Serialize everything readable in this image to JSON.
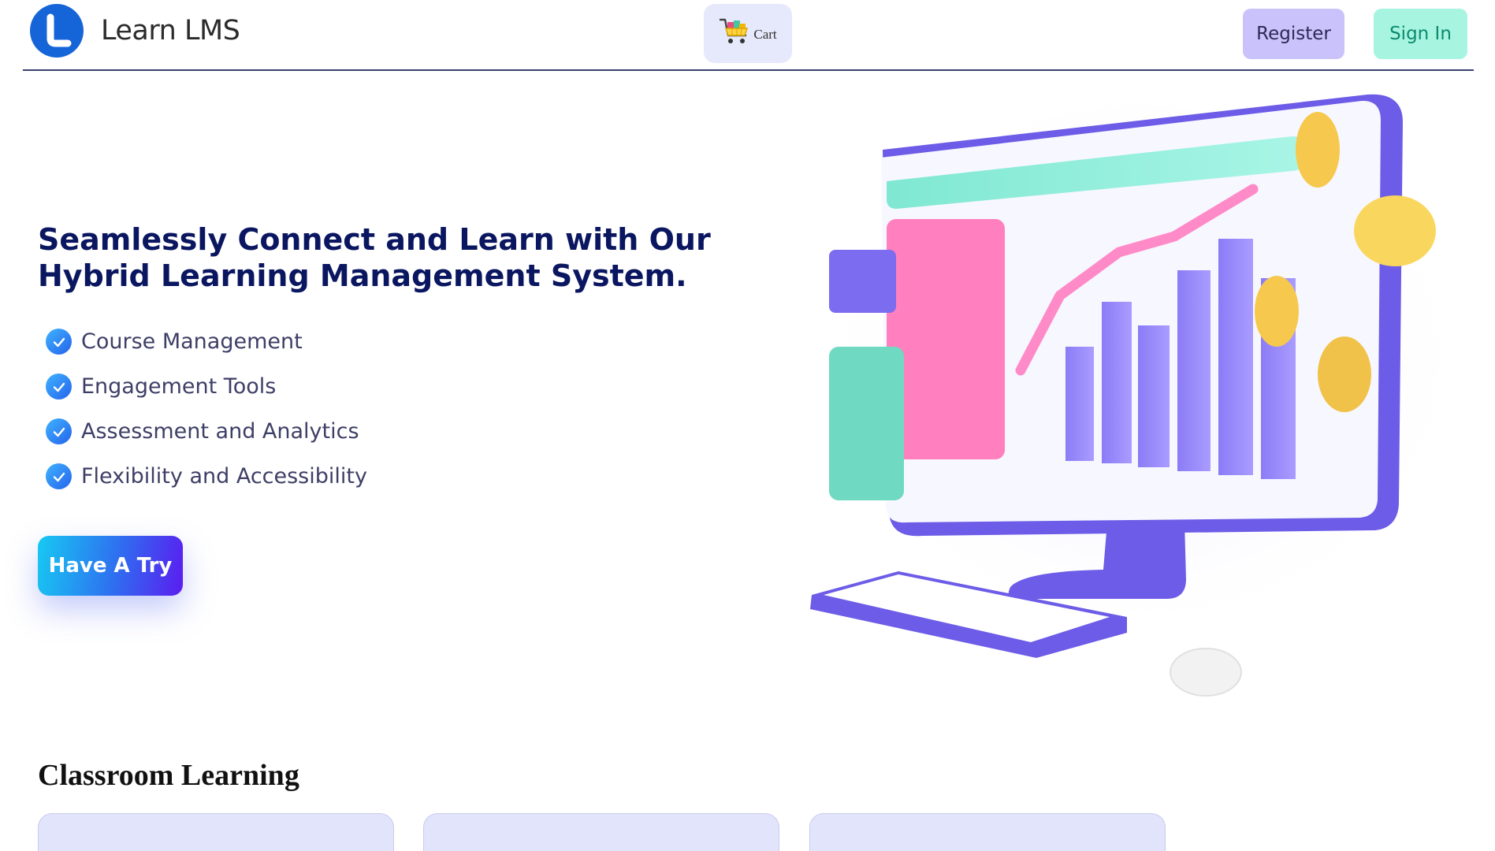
{
  "brand": {
    "name": "Learn LMS"
  },
  "header": {
    "cart_label": "Cart",
    "register_label": "Register",
    "signin_label": "Sign In"
  },
  "hero": {
    "title": "Seamlessly Connect and Learn with Our Hybrid Learning Management System.",
    "features": [
      "Course Management",
      "Engagement Tools",
      "Assessment and Analytics",
      "Flexibility and Accessibility"
    ],
    "cta_label": "Have A Try"
  },
  "classroom": {
    "title": "Classroom Learning",
    "card_count": 3
  },
  "colors": {
    "primary_text": "#0a1660",
    "logo_blue": "#1565d8",
    "register_bg": "#c9c2fb",
    "signin_bg": "#a7f5e0",
    "cta_gradient_start": "#17c9f2",
    "cta_gradient_end": "#5b1cf0",
    "card_bg": "#e2e4fb"
  },
  "icons": {
    "logo": "learn-lms-logo-icon",
    "cart": "shopping-cart-icon",
    "feature_check": "check-circle-icon"
  }
}
